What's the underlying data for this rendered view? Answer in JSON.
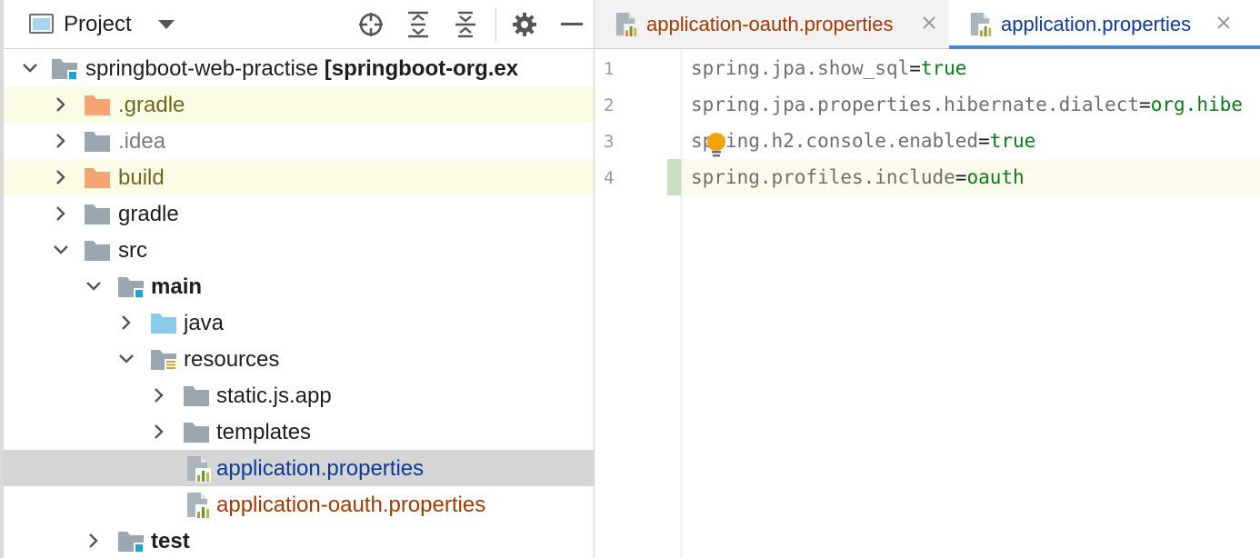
{
  "project_panel": {
    "title": "Project",
    "icons": [
      "project-view-icon",
      "chevron-down-icon",
      "locate-icon",
      "expand-all-icon",
      "collapse-all-icon",
      "gear-icon",
      "minimize-icon"
    ],
    "tree": [
      {
        "label": "springboot-web-practise",
        "suffix": "[springboot-org.ex",
        "icon": "module-folder-icon"
      },
      {
        "label": ".gradle",
        "icon": "excluded-folder-icon"
      },
      {
        "label": ".idea",
        "icon": "folder-icon"
      },
      {
        "label": "build",
        "icon": "excluded-folder-icon"
      },
      {
        "label": "gradle",
        "icon": "folder-icon"
      },
      {
        "label": "src",
        "icon": "folder-icon"
      },
      {
        "label": "main",
        "icon": "module-folder-icon"
      },
      {
        "label": "java",
        "icon": "source-folder-icon"
      },
      {
        "label": "resources",
        "icon": "resources-folder-icon"
      },
      {
        "label": "static.js.app",
        "icon": "folder-icon"
      },
      {
        "label": "templates",
        "icon": "folder-icon"
      },
      {
        "label": "application.properties",
        "icon": "properties-file-icon"
      },
      {
        "label": "application-oauth.properties",
        "icon": "properties-file-icon"
      },
      {
        "label": "test",
        "icon": "module-folder-icon"
      }
    ]
  },
  "editor": {
    "tabs": [
      {
        "label": "application-oauth.properties",
        "icon": "properties-file-icon"
      },
      {
        "label": "application.properties",
        "icon": "properties-file-icon"
      }
    ],
    "lines": [
      {
        "number": "1",
        "key": "spring.jpa.show_sql",
        "eq": "=",
        "value": "true"
      },
      {
        "number": "2",
        "key": "spring.jpa.properties.hibernate.dialect",
        "eq": "=",
        "value": "org.hibe"
      },
      {
        "number": "3",
        "key": "spring.h2.console.enabled",
        "eq": "=",
        "value": "true"
      },
      {
        "number": "4",
        "key": "spring.profiles.include",
        "eq": "=",
        "value": "oauth"
      }
    ],
    "intention_icon": "lightbulb-icon"
  },
  "colors": {
    "accent": "#4a86c8",
    "value_green": "#067d17",
    "selected_row": "#d5d5d5",
    "ignored_row": "#fbfbe6",
    "modified_blue": "#0a3a9b",
    "new_file_brown": "#a23a00"
  }
}
